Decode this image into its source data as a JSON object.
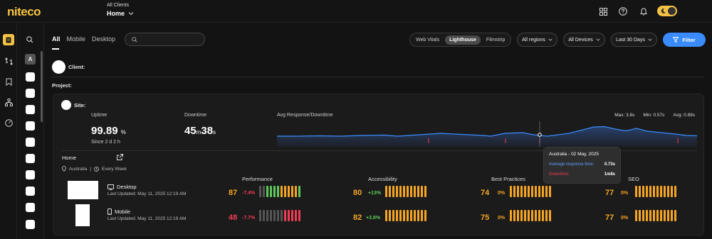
{
  "brand": {
    "logo": "niteco",
    "accent": "#f5c242"
  },
  "header": {
    "breadcrumb_top": "All Clients",
    "breadcrumb_main": "Home"
  },
  "tabs": [
    "All",
    "Mobile",
    "Desktop"
  ],
  "search": {
    "placeholder": ""
  },
  "view_modes": [
    "Web Vitals",
    "Lighthouse",
    "Filmstrip"
  ],
  "active_view": "Lighthouse",
  "filters": {
    "regions": "All regions",
    "devices": "All Devices",
    "range": "Last 30 Days",
    "filter_label": "Filter"
  },
  "client": {
    "label": "Client:"
  },
  "project": {
    "label": "Project:"
  },
  "site": {
    "label": "Site:",
    "uptime_label": "Uptime",
    "uptime_value": "99.89",
    "uptime_unit": "%",
    "uptime_since": "Since 2 d 2 h",
    "downtime_label": "Downtime",
    "downtime_minutes": "45",
    "downtime_m_unit": "m",
    "downtime_seconds": "38",
    "downtime_s_unit": "s",
    "response_label": "Avg Response/Downtime",
    "max": "Max: 3.8s",
    "min": "Min: 0.57s",
    "avg": "Avg: 0.89s"
  },
  "page": {
    "name": "Home",
    "region": "Australia",
    "frequency": "Every Week"
  },
  "categories": [
    "Performance",
    "Accessibility",
    "Best Practices",
    "SEO"
  ],
  "devices": [
    {
      "name": "Desktop",
      "updated": "Last Updated: May 11, 2025 12:19 AM",
      "scores": [
        {
          "value": "87",
          "delta": "-7.4%"
        },
        {
          "value": "80",
          "delta": "+13%"
        },
        {
          "value": "74",
          "delta": "0%"
        },
        {
          "value": "77",
          "delta": "0%"
        }
      ]
    },
    {
      "name": "Mobile",
      "updated": "Last Updated: May 11, 2025 12:19 AM",
      "scores": [
        {
          "value": "48",
          "delta": "-7.7%"
        },
        {
          "value": "82",
          "delta": "+3.8%"
        },
        {
          "value": "75",
          "delta": "0%"
        },
        {
          "value": "77",
          "delta": "0%"
        }
      ]
    }
  ],
  "tooltip": {
    "title": "Australia - 02 May, 2025",
    "response_label": "Average response time:",
    "response_value": "0.73s",
    "downtime_label": "Downtime:",
    "downtime_value": "1m8s"
  },
  "colors": {
    "good": "#5ec95a",
    "warn": "#f5a524",
    "bad": "#ef3b53",
    "blue": "#3a8bfd",
    "idle": "#555555"
  }
}
